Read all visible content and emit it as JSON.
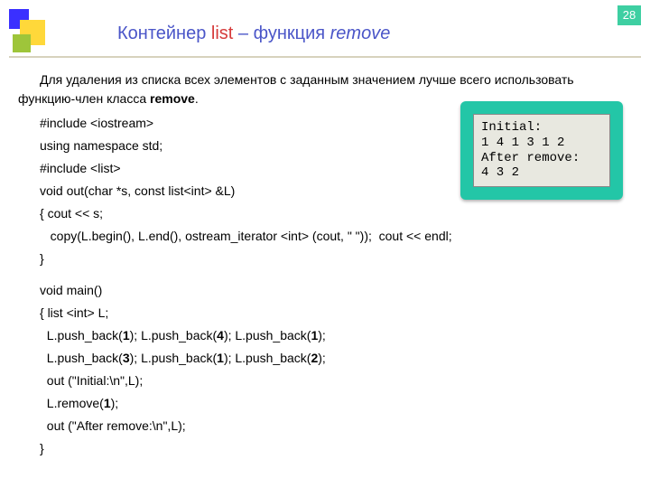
{
  "page_number": "28",
  "title": {
    "t1": "Контейнер ",
    "t2": "list",
    "t3": "  – функция ",
    "t4": "remove"
  },
  "intro": "Для удаления из списка всех элементов с заданным значением лучше всего использовать функцию-член класса remove.",
  "code": {
    "l1": "#include <iostream>",
    "l2": "using namespace std;",
    "l3": "#include <list>",
    "l4": "void out(char *s, const list<int> &L)",
    "l5": "{ cout << s;",
    "l6": "   copy(L.begin(), L.end(), ostream_iterator <int> (cout, \" \"));  cout << endl;",
    "l7": "}",
    "l8": "void main()",
    "l9": "{ list <int> L;",
    "l10": "  L.push_back(1); L.push_back(4); L.push_back(1);",
    "l11": "  L.push_back(3); L.push_back(1); L.push_back(2);",
    "l12": "  out (\"Initial:\\n\",L);",
    "l13": "  L.remove(1);",
    "l14": "  out (\"After remove:\\n\",L);",
    "l15": "}"
  },
  "output": {
    "line1": "Initial:",
    "line2": "1 4 1 3 1 2",
    "line3": "After remove:",
    "line4": "4 3 2"
  }
}
